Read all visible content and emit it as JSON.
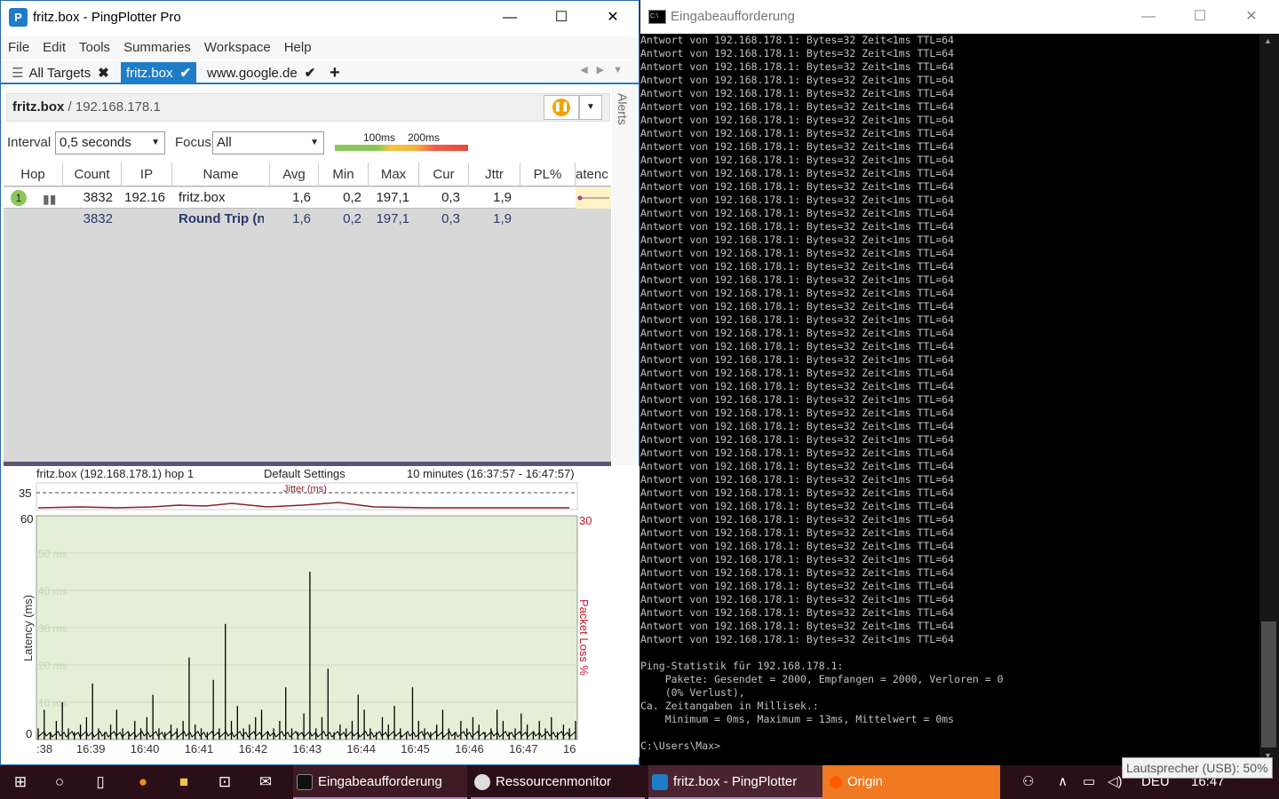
{
  "pingplotter": {
    "title": "fritz.box - PingPlotter Pro",
    "menu": [
      "File",
      "Edit",
      "Tools",
      "Summaries",
      "Workspace",
      "Help"
    ],
    "tabs": [
      {
        "label": "All Targets",
        "mark": "✖"
      },
      {
        "label": "fritz.box",
        "mark": "✔"
      },
      {
        "label": "www.google.de",
        "mark": "✔"
      }
    ],
    "add_tab": "+",
    "target_host": "fritz.box",
    "target_sep": " / ",
    "target_ip": "192.168.178.1",
    "alerts_label": "Alerts",
    "interval_label": "Interval",
    "interval_value": "0,5 seconds",
    "focus_label": "Focus",
    "focus_value": "All",
    "scale_100": "100ms",
    "scale_200": "200ms",
    "columns": [
      "Hop",
      "Count",
      "IP",
      "Name",
      "Avg",
      "Min",
      "Max",
      "Cur",
      "Jttr",
      "PL%",
      "atenc"
    ],
    "hop_row": {
      "hop": "1",
      "count": "3832",
      "ip": "192.16",
      "name": "fritz.box",
      "avg": "1,6",
      "min": "0,2",
      "max": "197,1",
      "cur": "0,3",
      "jttr": "1,9"
    },
    "round_trip": {
      "count": "3832",
      "name": "Round Trip (n",
      "avg": "1,6",
      "min": "0,2",
      "max": "197,1",
      "cur": "0,3",
      "jttr": "1,9"
    },
    "chart_header": {
      "host": "fritz.box (192.168.178.1) hop 1",
      "settings": "Default Settings",
      "range": "10 minutes (16:37:57 - 16:47:57)"
    }
  },
  "chart_data": {
    "type": "line",
    "title": "fritz.box (192.168.178.1) hop 1",
    "xlabel": "",
    "ylabel": "Latency (ms)",
    "y2label": "Packet Loss %",
    "jitter_label": "Jitter (ms)",
    "jitter_max": "35",
    "ylim": [
      0,
      60
    ],
    "y2max": "30",
    "y_grid_labels": [
      "50 ms",
      "40 ms",
      "30 ms",
      "20 ms",
      "10 ms"
    ],
    "y_axis_ticks": [
      "60",
      "0"
    ],
    "x_ticks": [
      ":38",
      "16:39",
      "16:40",
      "16:41",
      "16:42",
      "16:43",
      "16:44",
      "16:45",
      "16:46",
      "16:47",
      "16"
    ],
    "series": [
      {
        "values": [
          3,
          8,
          2,
          5,
          10,
          3,
          2,
          4,
          6,
          15,
          3,
          2,
          4,
          8,
          3,
          2,
          5,
          3,
          6,
          12,
          3,
          2,
          4,
          3,
          5,
          22,
          4,
          3,
          2,
          16,
          3,
          31,
          5,
          9,
          3,
          4,
          6,
          8,
          2,
          3,
          5,
          14,
          3,
          2,
          7,
          45,
          3,
          6,
          19,
          2,
          4,
          3,
          5,
          12,
          8,
          3,
          2,
          6,
          4,
          9,
          3,
          2,
          14,
          5,
          3,
          2,
          4,
          8,
          3,
          2,
          5,
          3,
          6,
          4,
          2,
          3,
          8,
          5,
          2,
          3,
          7,
          4,
          2,
          5,
          3,
          6,
          2,
          4,
          3,
          5
        ]
      }
    ],
    "color": "#000000",
    "background": "#e3f0d6"
  },
  "cmd": {
    "title": "Eingabeaufforderung",
    "reply_line": "Antwort von 192.168.178.1: Bytes=32 Zeit<1ms TTL=64",
    "reply_count": 46,
    "stats": "Ping-Statistik für 192.168.178.1:\n    Pakete: Gesendet = 2000, Empfangen = 2000, Verloren = 0\n    (0% Verlust),\nCa. Zeitangaben in Millisek.:\n    Minimum = 0ms, Maximum = 13ms, Mittelwert = 0ms",
    "prompt": "C:\\Users\\Max>"
  },
  "taskbar": {
    "apps": [
      "Eingabeaufforderung",
      "Ressourcenmonitor",
      "fritz.box - PingPlotter",
      "Origin"
    ],
    "lang": "DEU",
    "time": "16:47",
    "tooltip": "Lautsprecher (USB): 50%"
  }
}
